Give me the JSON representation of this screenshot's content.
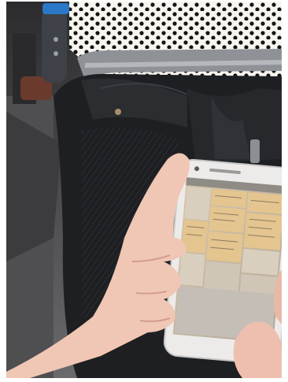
{
  "scene": {
    "description_tag": "photo-hand-holding-smartphone",
    "colors": {
      "polka_fabric": "#f7f5ef",
      "polka_dot": "#141414",
      "bag_leather": "#1d1f22",
      "bag_highlight": "#3a3d42",
      "floor": "#5a5a5c",
      "skin": "#f0c6b4",
      "skin_shadow": "#d49e8b",
      "phone_body": "#ecebea",
      "phone_screen": "#c9b79b",
      "screen_cell": "#e4c58f",
      "screen_cell_alt": "#d9cfbf",
      "screen_header": "#8f8c86",
      "handle_blue": "#2b78c9",
      "rail": "#8e9297"
    }
  }
}
